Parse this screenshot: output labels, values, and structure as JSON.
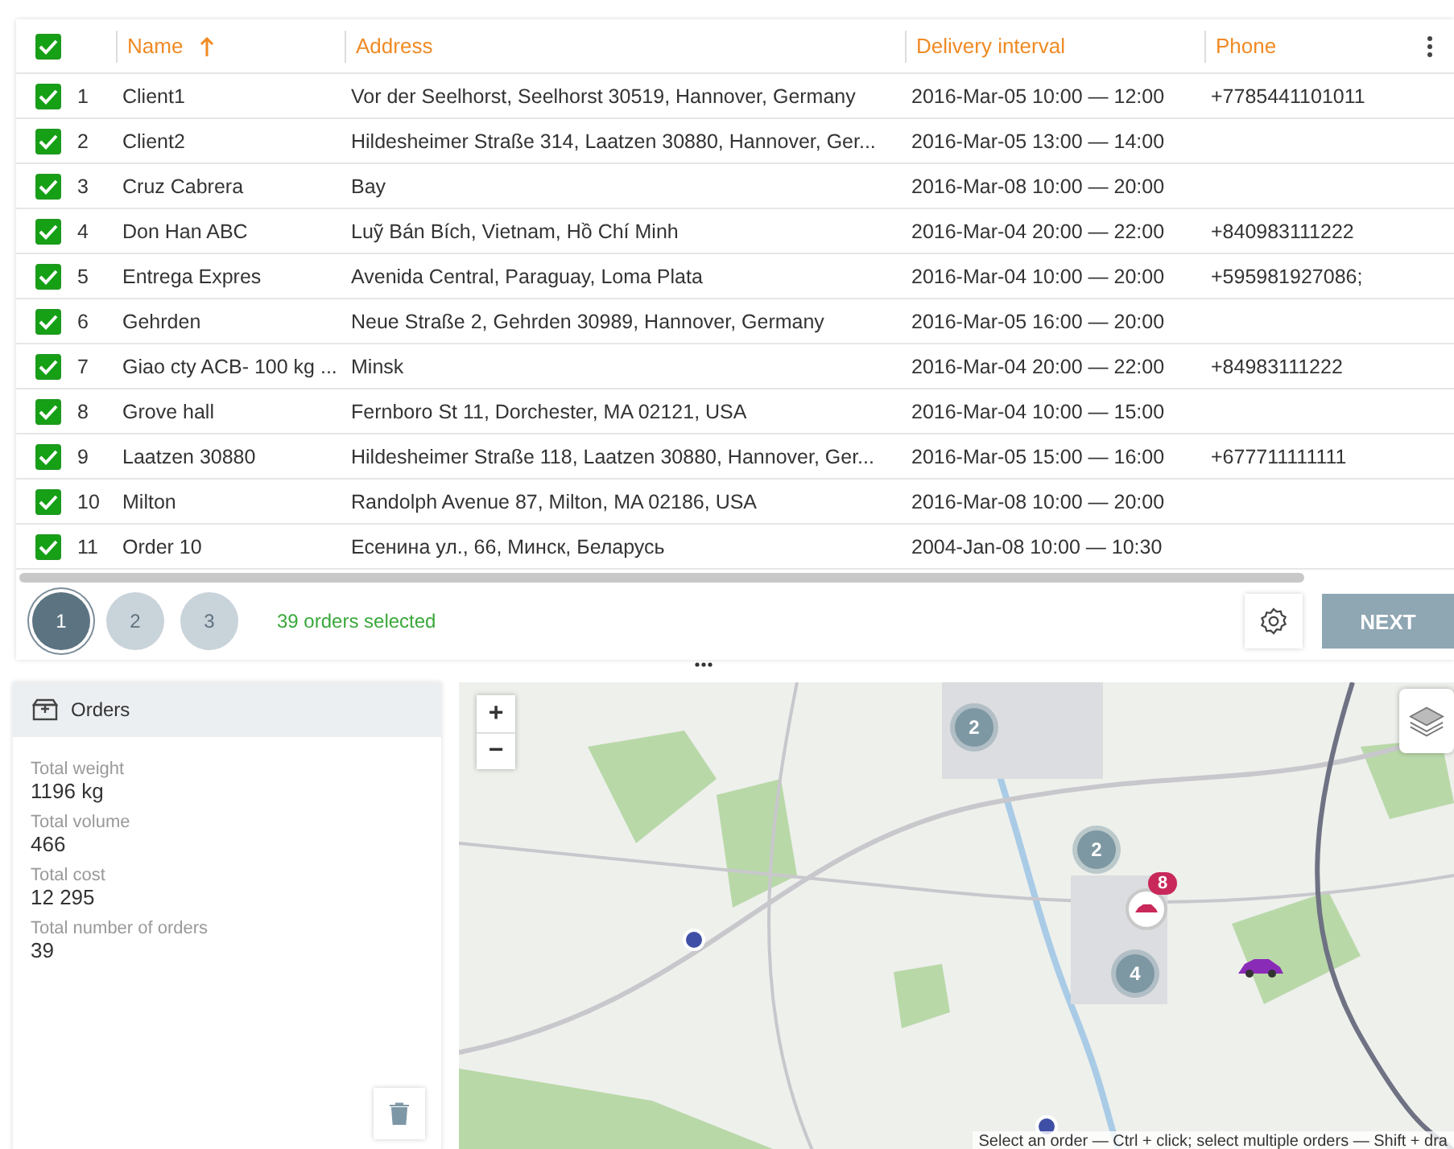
{
  "table": {
    "all_checked": true,
    "columns": [
      {
        "label": "Name",
        "sorted": true
      },
      {
        "label": "Address",
        "sorted": false
      },
      {
        "label": "Delivery interval",
        "sorted": false
      },
      {
        "label": "Phone",
        "sorted": false
      }
    ],
    "rows": [
      {
        "checked": true,
        "number": "1",
        "name": "Client1",
        "address": "Vor der Seelhorst, Seelhorst 30519, Hannover, Germany",
        "interval": "2016-Mar-05 10:00 — 12:00",
        "phone": "+7785441101011"
      },
      {
        "checked": true,
        "number": "2",
        "name": "Client2",
        "address": "Hildesheimer Straße 314, Laatzen 30880, Hannover, Ger...",
        "interval": "2016-Mar-05 13:00 — 14:00",
        "phone": ""
      },
      {
        "checked": true,
        "number": "3",
        "name": "Cruz Cabrera",
        "address": "Bay",
        "interval": "2016-Mar-08 10:00 — 20:00",
        "phone": ""
      },
      {
        "checked": true,
        "number": "4",
        "name": "Don Han ABC",
        "address": "Luỹ Bán Bích, Vietnam, Hồ Chí Minh",
        "interval": "2016-Mar-04 20:00 — 22:00",
        "phone": "+840983111222"
      },
      {
        "checked": true,
        "number": "5",
        "name": "Entrega Expres",
        "address": "Avenida Central, Paraguay, Loma Plata",
        "interval": "2016-Mar-04 10:00 — 20:00",
        "phone": "+595981927086;"
      },
      {
        "checked": true,
        "number": "6",
        "name": "Gehrden",
        "address": "Neue Straße 2, Gehrden 30989, Hannover, Germany",
        "interval": "2016-Mar-05 16:00 — 20:00",
        "phone": ""
      },
      {
        "checked": true,
        "number": "7",
        "name": "Giao cty ACB- 100 kg ...",
        "address": "Minsk",
        "interval": "2016-Mar-04 20:00 — 22:00",
        "phone": "+84983111222"
      },
      {
        "checked": true,
        "number": "8",
        "name": "Grove hall",
        "address": "Fernboro St 11, Dorchester, MA 02121, USA",
        "interval": "2016-Mar-04 10:00 — 15:00",
        "phone": ""
      },
      {
        "checked": true,
        "number": "9",
        "name": "Laatzen 30880",
        "address": "Hildesheimer Straße 118, Laatzen 30880, Hannover, Ger...",
        "interval": "2016-Mar-05 15:00 — 16:00",
        "phone": "+677711111111"
      },
      {
        "checked": true,
        "number": "10",
        "name": "Milton",
        "address": "Randolph Avenue 87, Milton, MA 02186, USA",
        "interval": "2016-Mar-08 10:00 — 20:00",
        "phone": ""
      },
      {
        "checked": true,
        "number": "11",
        "name": "Order 10",
        "address": "Есенина ул., 66, Минск, Беларусь",
        "interval": "2004-Jan-08 10:00 — 10:30",
        "phone": ""
      }
    ]
  },
  "pagination": {
    "pages": [
      {
        "label": "1",
        "selected": true
      },
      {
        "label": "2",
        "selected": false
      },
      {
        "label": "3",
        "selected": false
      }
    ],
    "selection_note": "39 orders selected",
    "next_button": "NEXT"
  },
  "orders_panel": {
    "title": "Orders",
    "stats": [
      {
        "label": "Total weight",
        "value": "1196 kg"
      },
      {
        "label": "Total volume",
        "value": "466"
      },
      {
        "label": "Total cost",
        "value": "12 295"
      },
      {
        "label": "Total number of orders",
        "value": "39"
      }
    ]
  },
  "map": {
    "kind": "picture",
    "zoom_in": "+",
    "zoom_out": "−",
    "markers": [
      {
        "kind": "cluster",
        "label": "2"
      },
      {
        "kind": "cluster",
        "label": "2"
      },
      {
        "kind": "cluster",
        "label": "4"
      },
      {
        "kind": "vehicle",
        "label": "8"
      },
      {
        "kind": "order"
      },
      {
        "kind": "order"
      },
      {
        "kind": "vehicle_moving"
      }
    ],
    "hint": "Select an order — Ctrl + click; select multiple orders — Shift + dra"
  }
}
